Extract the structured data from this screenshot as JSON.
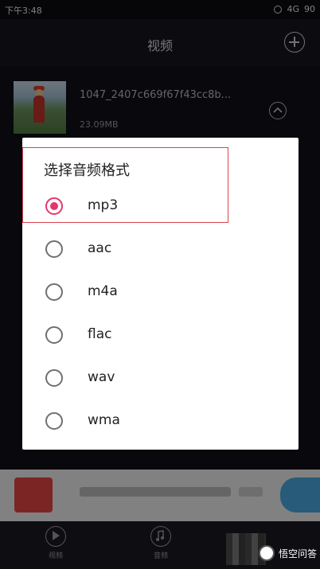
{
  "status_bar": {
    "time": "下午3:48",
    "signal": "4G",
    "battery": "90"
  },
  "header": {
    "title": "视频"
  },
  "video": {
    "name": "1047_2407c669f67f43cc8b...",
    "size": "23.09MB"
  },
  "dialog": {
    "title": "选择音频格式",
    "selected": "mp3",
    "options": [
      {
        "label": "mp3",
        "checked": true
      },
      {
        "label": "aac",
        "checked": false
      },
      {
        "label": "m4a",
        "checked": false
      },
      {
        "label": "flac",
        "checked": false
      },
      {
        "label": "wav",
        "checked": false
      },
      {
        "label": "wma",
        "checked": false
      }
    ]
  },
  "bottom_nav": {
    "items": [
      {
        "label": "视频",
        "icon": "play-icon"
      },
      {
        "label": "音频",
        "icon": "music-note-icon"
      }
    ]
  },
  "watermark": {
    "text": "悟空问答"
  },
  "colors": {
    "accent": "#e8356d",
    "highlight": "#d9414c"
  }
}
